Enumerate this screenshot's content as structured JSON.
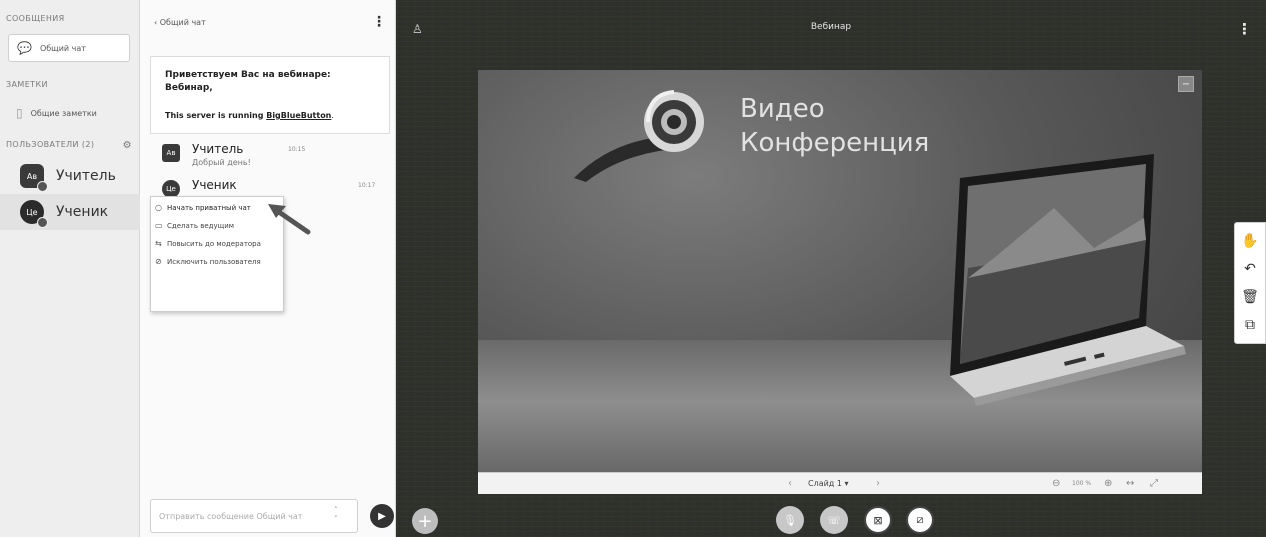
{
  "userlist": {
    "messages_title": "СООБЩЕНИЯ",
    "public_chat_label": "Общий чат",
    "notes_title": "ЗАМЕТКИ",
    "shared_notes_label": "Общие заметки",
    "users_title": "ПОЛЬЗОВАТЕЛИ (2)",
    "users": [
      {
        "initials": "Ав",
        "name": "Учитель"
      },
      {
        "initials": "Це",
        "name": "Ученик"
      }
    ]
  },
  "chat": {
    "header_back": "‹ Общий чат",
    "welcome_line1": "Приветствуем Вас на вебинаре:",
    "welcome_line2": "Вебинар,",
    "server_text": "This server is running ",
    "server_link": "BigBlueButton",
    "server_end": ".",
    "messages": [
      {
        "initials": "Ав",
        "name": "Учитель",
        "time": "10:15",
        "text": "Добрый день!"
      },
      {
        "initials": "Це",
        "name": "Ученик",
        "time": "10:17",
        "text": ""
      }
    ],
    "context_menu": [
      {
        "icon": "💬",
        "label": "Начать приватный чат"
      },
      {
        "icon": "▭",
        "label": "Сделать ведущим"
      },
      {
        "icon": "⇆",
        "label": "Повысить до модератора"
      },
      {
        "icon": "⊘",
        "label": "Исключить пользователя"
      }
    ],
    "input_placeholder": "Отправить сообщение Общий чат"
  },
  "presentation": {
    "meeting_title": "Вебинар",
    "slide_title_line1": "Видео",
    "slide_title_line2": "Конференция",
    "slide_selector": "Слайд 1",
    "zoom_level": "100 %"
  },
  "icons": {
    "accent": "#333333"
  }
}
